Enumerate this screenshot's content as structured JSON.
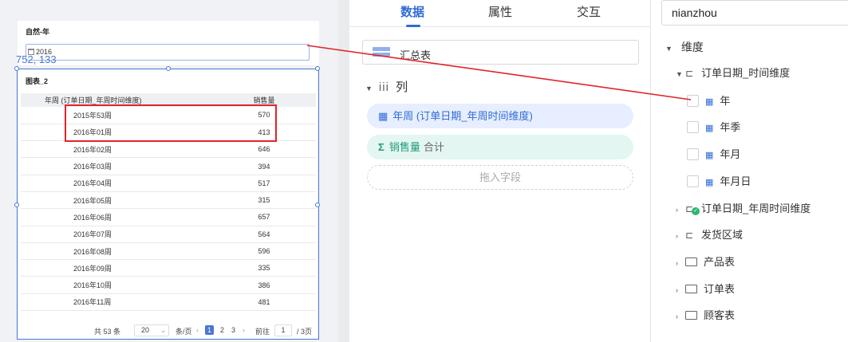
{
  "canvas": {
    "filter": {
      "title": "自然-年",
      "value": "2016"
    },
    "coord_readout": "752, 133",
    "table": {
      "title": "图表_2",
      "headers": [
        "年周 (订单日期_年周时间维度)",
        "销售量"
      ],
      "rows": [
        [
          "2015年53周",
          "570"
        ],
        [
          "2016年01周",
          "413"
        ],
        [
          "2016年02周",
          "646"
        ],
        [
          "2016年03周",
          "394"
        ],
        [
          "2016年04周",
          "517"
        ],
        [
          "2016年05周",
          "315"
        ],
        [
          "2016年06周",
          "657"
        ],
        [
          "2016年07周",
          "564"
        ],
        [
          "2016年08周",
          "596"
        ],
        [
          "2016年09周",
          "335"
        ],
        [
          "2016年10周",
          "386"
        ],
        [
          "2016年11周",
          "481"
        ]
      ]
    },
    "pager": {
      "total": "共 53 条",
      "page_size": "20",
      "per_page": "条/页",
      "prev": "‹",
      "pages": [
        "1",
        "2",
        "3"
      ],
      "next": "›",
      "goto_label": "前往",
      "goto_value": "1",
      "total_pages": "/ 3页"
    },
    "annotation_color": "#e0242a"
  },
  "middle": {
    "tabs": [
      "数据",
      "属性",
      "交互"
    ],
    "active_tab": 0,
    "source": "汇总表",
    "section_title": "列",
    "dimension_chip": "年周 (订单日期_年周时间维度)",
    "measure_chip": {
      "name": "销售量",
      "agg": "合计"
    },
    "drop_placeholder": "拖入字段"
  },
  "right": {
    "search_value": "nianzhou",
    "root": "维度",
    "tree": [
      {
        "label": "订单日期_时间维度",
        "kind": "hierarchy",
        "expanded": true
      },
      {
        "label": "年",
        "kind": "level"
      },
      {
        "label": "年季",
        "kind": "level"
      },
      {
        "label": "年月",
        "kind": "level"
      },
      {
        "label": "年月日",
        "kind": "level"
      },
      {
        "label": "订单日期_年周时间维度",
        "kind": "hierarchy-ok"
      },
      {
        "label": "发货区域",
        "kind": "hierarchy"
      },
      {
        "label": "产品表",
        "kind": "folder"
      },
      {
        "label": "订单表",
        "kind": "folder"
      },
      {
        "label": "顾客表",
        "kind": "folder"
      }
    ]
  },
  "colors": {
    "accent": "#2f6bd6",
    "measure": "#1f9a7a",
    "selection": "#4a76d6"
  }
}
